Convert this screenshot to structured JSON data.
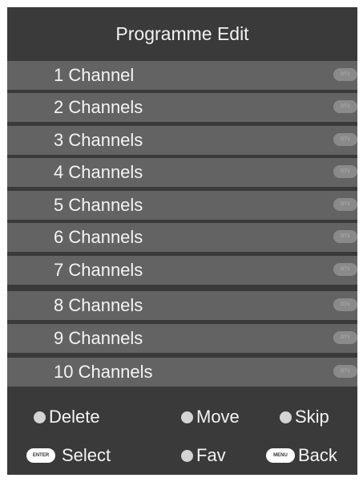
{
  "header": {
    "title": "Programme Edit"
  },
  "channels": [
    {
      "label": "1 Channel",
      "badge": "DTV"
    },
    {
      "label": "2 Channels",
      "badge": "DTV"
    },
    {
      "label": "3 Channels",
      "badge": "DTV"
    },
    {
      "label": "4 Channels",
      "badge": "DTV"
    },
    {
      "label": "5 Channels",
      "badge": "DTV"
    },
    {
      "label": "6 Channels",
      "badge": "DTV"
    },
    {
      "label": "7 Channels",
      "badge": "DTV"
    },
    {
      "label": "8 Channels",
      "badge": "DTV"
    },
    {
      "label": "9 Channels",
      "badge": "DTV"
    },
    {
      "label": "10 Channels",
      "badge": "DTV"
    }
  ],
  "footer": {
    "delete_label": "Delete",
    "move_label": "Move",
    "skip_label": "Skip",
    "enter_key": "ENTER",
    "select_label": "Select",
    "fav_label": "Fav",
    "menu_key": "MENU",
    "back_label": "Back"
  },
  "colors": {
    "panel_bg": "#3a3a3a",
    "row_bg": "#636363",
    "text": "#f4f4f4",
    "badge_bg": "#8a8a8a",
    "dot": "#d4d4d4"
  }
}
